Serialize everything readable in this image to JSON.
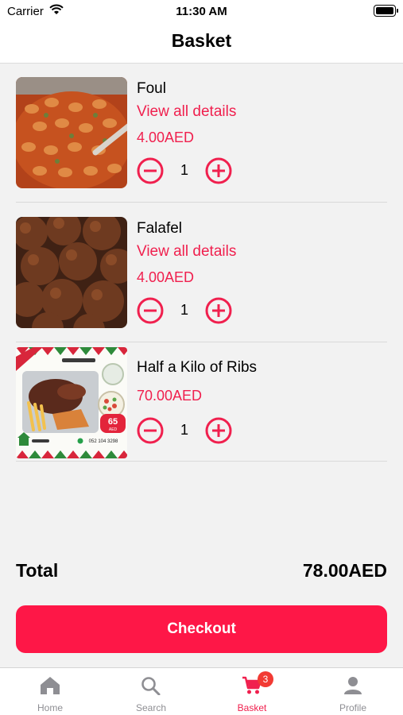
{
  "status_bar": {
    "carrier": "Carrier",
    "time": "11:30 AM"
  },
  "header": {
    "title": "Basket"
  },
  "basket": {
    "items": [
      {
        "name": "Foul",
        "details_link": "View all details",
        "price": "4.00AED",
        "quantity": "1",
        "image": "foul-dish-photo"
      },
      {
        "name": "Falafel",
        "details_link": "View all details",
        "price": "4.00AED",
        "quantity": "1",
        "image": "falafel-photo"
      },
      {
        "name": "Half a Kilo of Ribs",
        "details_link": "",
        "price": "70.00AED",
        "quantity": "1",
        "image": "ribs-promo-poster"
      }
    ],
    "promo_poster": {
      "price_badge": "65",
      "currency": "AED",
      "phone": "052 104 3298"
    }
  },
  "summary": {
    "total_label": "Total",
    "total_value": "78.00AED"
  },
  "checkout": {
    "label": "Checkout"
  },
  "tabbar": {
    "tabs": [
      {
        "label": "Home",
        "icon": "home-icon"
      },
      {
        "label": "Search",
        "icon": "search-icon"
      },
      {
        "label": "Basket",
        "icon": "cart-icon",
        "badge": "3",
        "active": true
      },
      {
        "label": "Profile",
        "icon": "profile-icon"
      }
    ]
  },
  "colors": {
    "accent": "#f0204e",
    "checkout_button": "#fe1747",
    "badge": "#f23a33",
    "inactive_tab": "#8e8e93"
  }
}
